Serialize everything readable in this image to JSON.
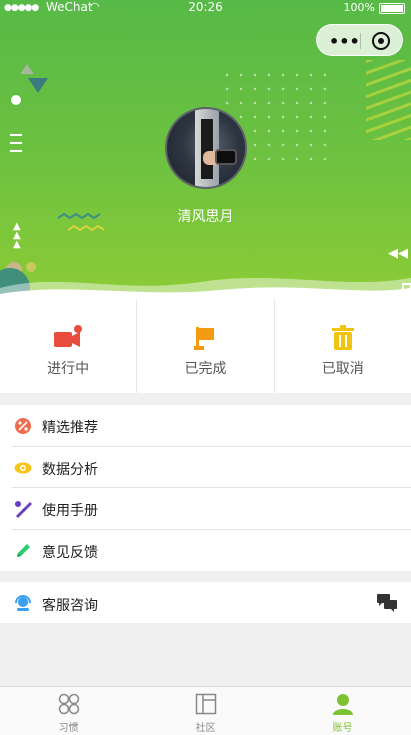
{
  "status_bar": {
    "signal": "●●●●●",
    "carrier": "WeChat",
    "time": "20:26",
    "battery": "100%"
  },
  "capsule": {
    "more_icon": "more-dots-icon",
    "close_icon": "target-circle-icon"
  },
  "profile": {
    "username": "清风思月"
  },
  "orders": [
    {
      "label": "进行中",
      "icon": "video-camera-icon",
      "color": "#e84c3d"
    },
    {
      "label": "已完成",
      "icon": "flag-icon",
      "color": "#f39c12"
    },
    {
      "label": "已取消",
      "icon": "trash-icon",
      "color": "#f1c40f"
    }
  ],
  "menu": [
    {
      "label": "精选推荐",
      "icon": "discount-icon",
      "color": "#f26b4f"
    },
    {
      "label": "数据分析",
      "icon": "eye-icon",
      "color": "#f5c518"
    },
    {
      "label": "使用手册",
      "icon": "tools-icon",
      "color": "#6a3fbf"
    },
    {
      "label": "意见反馈",
      "icon": "pencil-icon",
      "color": "#2ecc71"
    }
  ],
  "service": {
    "label": "客服咨询",
    "icon": "headset-icon",
    "chat_icon": "chat-bubbles-icon",
    "color": "#3aa0f0"
  },
  "tabs": [
    {
      "label": "习惯",
      "icon": "habit-icon",
      "active": false
    },
    {
      "label": "社区",
      "icon": "community-icon",
      "active": false
    },
    {
      "label": "账号",
      "icon": "account-icon",
      "active": true
    }
  ],
  "colors": {
    "accent": "#7cc233",
    "header_start": "#57b947",
    "header_end": "#8dcb36"
  }
}
